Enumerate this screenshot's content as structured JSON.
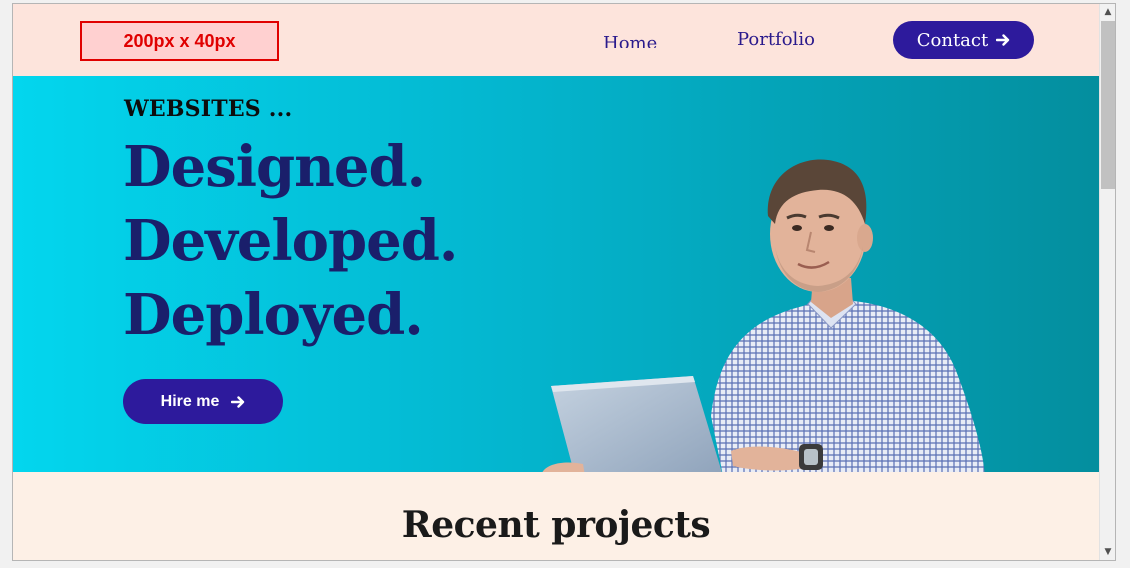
{
  "header": {
    "logo_placeholder": "200px x 40px",
    "nav": {
      "home": "Home",
      "portfolio": "Portfolio",
      "contact": "Contact"
    }
  },
  "hero": {
    "kicker": "WEBSITES ...",
    "headline": [
      "Designed.",
      "Developed.",
      "Deployed."
    ],
    "cta": "Hire me"
  },
  "section": {
    "title": "Recent projects"
  },
  "colors": {
    "header_bg": "#fde4dc",
    "brand_purple": "#2d1a9c",
    "headline_navy": "#1a1f6b",
    "hero_gradient_start": "#03d6ee",
    "hero_gradient_end": "#048e9e",
    "section_bg": "#fdf0e6"
  },
  "icons": [
    "arrow-right-icon",
    "scroll-up-icon",
    "scroll-down-icon"
  ]
}
